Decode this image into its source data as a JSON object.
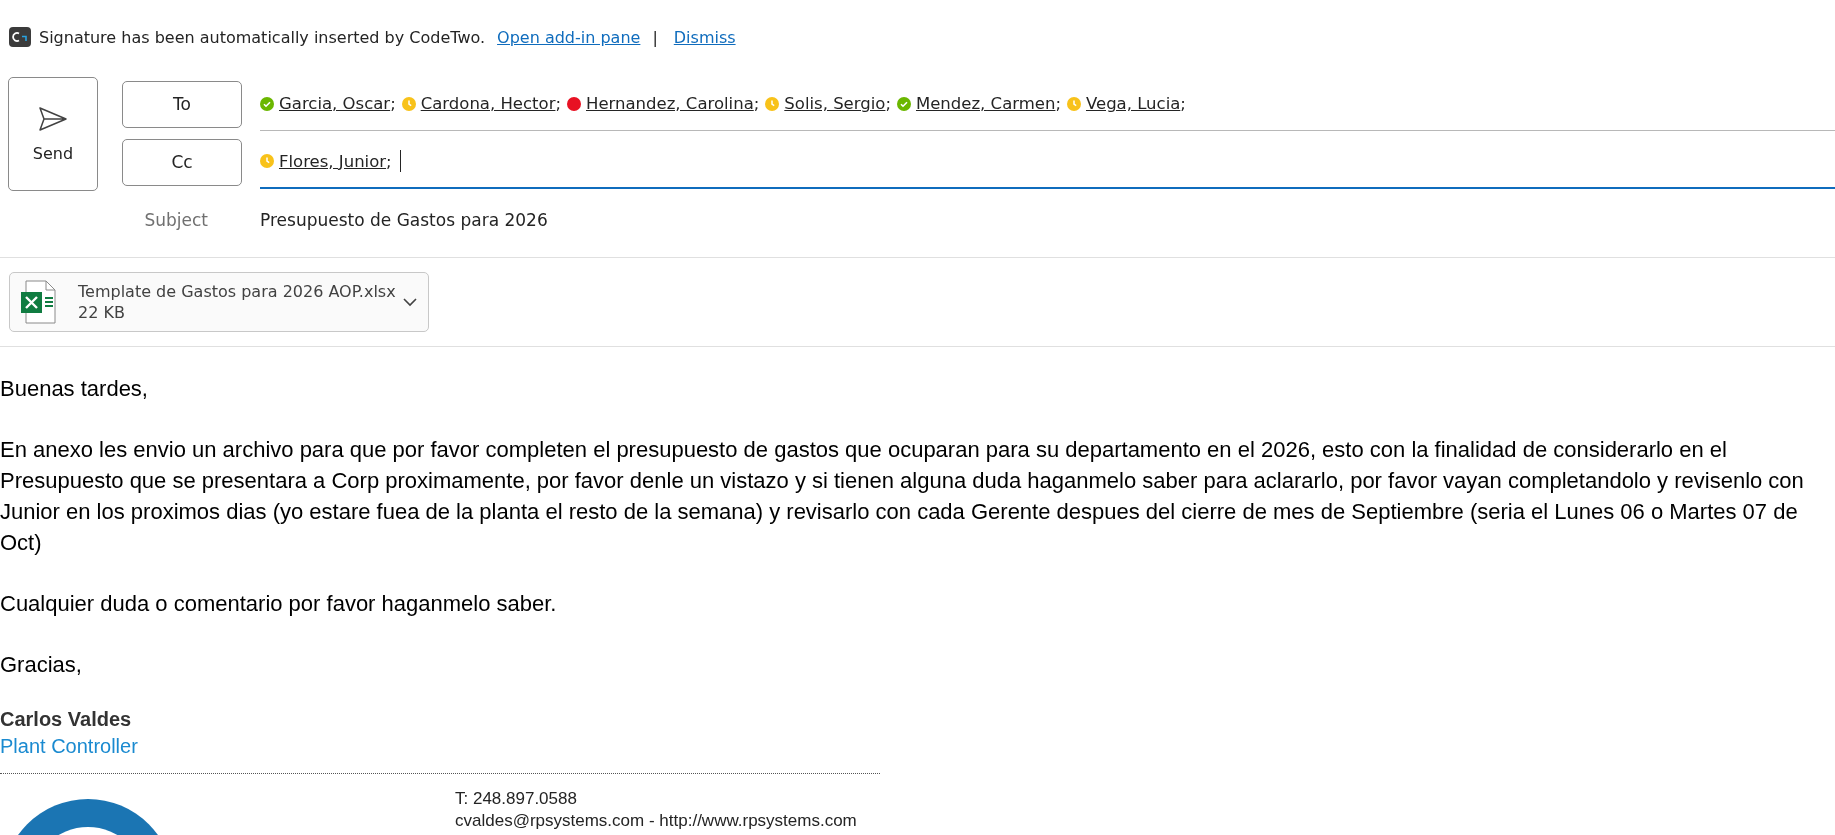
{
  "banner": {
    "message": "Signature has been automatically inserted by CodeTwo.",
    "links": [
      "Open add-in pane",
      "Dismiss"
    ],
    "separator": "|"
  },
  "send_button": {
    "label": "Send"
  },
  "to": {
    "label": "To",
    "recipients": [
      {
        "name": "Garcia, Oscar",
        "kind": "available",
        "delimiter": ";"
      },
      {
        "name": "Cardona, Hector",
        "kind": "away",
        "delimiter": ";"
      },
      {
        "name": "Hernandez, Carolina",
        "kind": "busy",
        "delimiter": ";"
      },
      {
        "name": "Solis, Sergio",
        "kind": "away",
        "delimiter": ";"
      },
      {
        "name": "Mendez, Carmen",
        "kind": "available",
        "delimiter": ";"
      },
      {
        "name": "Vega, Lucia",
        "kind": "away",
        "delimiter": ";"
      }
    ]
  },
  "cc": {
    "label": "Cc",
    "recipients": [
      {
        "name": "Flores, Junior",
        "kind": "away",
        "delimiter": ";"
      }
    ]
  },
  "subject": {
    "label": "Subject",
    "value": "Presupuesto de Gastos para 2026"
  },
  "attachment": {
    "name": "Template de Gastos para 2026 AOP.xlsx",
    "size": "22 KB"
  },
  "body": [
    "Buenas tardes,",
    "En anexo les envio un archivo para que por favor completen el presupuesto de gastos que ocuparan para su departamento en el 2026, esto con la finalidad de considerarlo en el Presupuesto que se presentara a Corp proximamente, por favor denle un vistazo y si tienen alguna duda haganmelo saber para aclararlo, por favor vayan completandolo y revisenlo con Junior en los proximos dias (yo estare fuea de la planta el resto de la semana) y revisarlo con cada Gerente despues del cierre de mes de Septiembre (seria el Lunes 06 o Martes 07 de Oct)",
    "Cualquier duda o comentario por favor haganmelo saber.",
    "Gracias,"
  ],
  "signature": {
    "name": "Carlos Valdes",
    "title": "Plant Controller",
    "phone": "T: 248.897.0588",
    "email": "cvaldes@rpsystems.com",
    "dash": "-",
    "website": "http://www.rpsystems.com"
  }
}
